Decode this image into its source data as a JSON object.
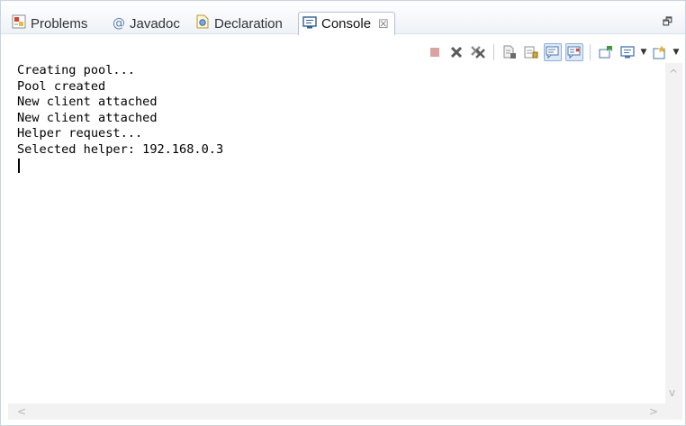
{
  "tabs": [
    {
      "label": "Problems",
      "icon": "problems-icon",
      "active": false
    },
    {
      "label": "Javadoc",
      "icon": "at-sign-icon",
      "active": false
    },
    {
      "label": "Declaration",
      "icon": "declaration-icon",
      "active": false
    },
    {
      "label": "Console",
      "icon": "console-icon",
      "active": true,
      "close": "☒"
    }
  ],
  "view_menu": {
    "restore_glyph": "🗗"
  },
  "toolbar": {
    "items": [
      "terminate-icon",
      "remove-launch-icon",
      "remove-all-terminated-icon",
      "clear-console-icon",
      "scroll-lock-icon",
      "show-console-on-stdout-icon",
      "show-console-on-stderr-icon",
      "pin-console-icon",
      "display-selected-console-icon",
      "open-console-icon"
    ],
    "pressed": [
      "show-console-on-stdout-icon",
      "show-console-on-stderr-icon"
    ]
  },
  "console": {
    "lines": [
      "Creating pool...",
      "Pool created",
      "New client attached",
      "New client attached",
      "Helper request...",
      "Selected helper: 192.168.0.3"
    ]
  },
  "colors": {
    "tab_border": "#b6c3d6",
    "tabbar_bg": "#eef2f8",
    "console_text": "#000000",
    "scrollbar_bg": "#f2f2f2"
  }
}
